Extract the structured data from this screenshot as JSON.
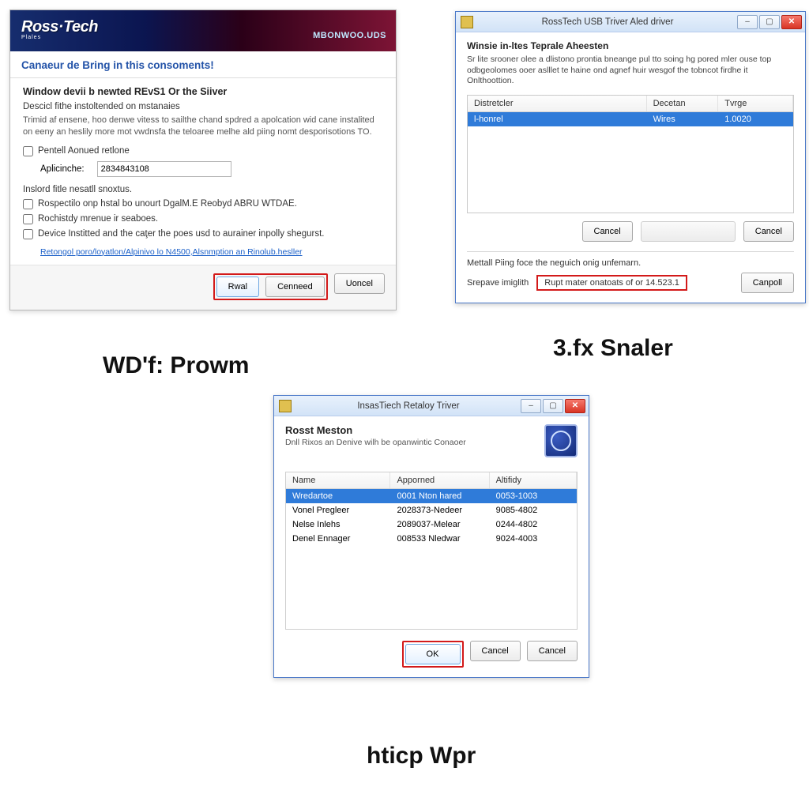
{
  "captions": {
    "c1": "WD'f: Prowm",
    "c2": "3.fx Snaler",
    "c3": "hticp Wpr"
  },
  "win1": {
    "logo_main": "Ross·Tech",
    "logo_sub": "Plales",
    "banner_right": "MBONWOO.UDS",
    "blue_heading": "Canaeur de Bring in this consoments!",
    "heading": "Window devii b newted REvS1 Or the Siiver",
    "subheading": "Descicl fithe instoltended on mstanaies",
    "description": "Trimid af ensene, hoo denwe vitess to sailthe chand spdred a apolcation wid cane instalited on eeny an heslily more mot vwdnsfa the teloaree melhe ald piing nomt desporisotions TO.",
    "chk1_label": "Pentell Aonued retlone",
    "apl_label": "Aplicinche:",
    "apl_value": "2834843108",
    "subheading2": "Inslord fitle nesatll snoxtus.",
    "chk2_label": "Rospectilo onp hstal bo unourt DgalM.E Reobyd ABRU WTDAE.",
    "chk3_label": "Rochistdy mrenue ir seaboes.",
    "chk4_label": "Device Institted and the caţer the poes usd to aurainer inpolly shegurst.",
    "link_text": "Retongol poro/loyatlon/Alpinivo lo N4500,Alsnmption an Rinolub.hesller",
    "btn_install": "Rwal",
    "btn_cancel": "Cenneed",
    "btn_uoncel": "Uoncel"
  },
  "win2": {
    "title": "RossTech USB Triver Aled driver",
    "heading": "Winsie in-ltes Teprale Aheesten",
    "paragraph": "Sr lite srooner olee a dlistono prontia bneange pul tto soing hg pored mler ouse top odbgeolomes ooer aslllet te haine ond agnef huir wesgof the tobncot firdhe it Onlthoottion.",
    "columns": {
      "c1": "Distretcler",
      "c2": "Decetan",
      "c3": "Tvrge"
    },
    "row": {
      "c1": "l-honrel",
      "c2": "Wires",
      "c3": "1.0020"
    },
    "btn_cancel_l": "Cancel",
    "btn_cancel_r": "Cancel",
    "sub_lab": "Mettall Piing foce the neguich onig unfemarn.",
    "sub_field_label": "Srepave imiglith",
    "sub_field_value": "Rupt mater onatoats of or 14.523.1",
    "btn_canpoll": "Canpoll"
  },
  "win3": {
    "title": "InsasTiech Retaloy Triver",
    "heading": "Rosst Meston",
    "sub": "Dnll Rixos an Denive wilh be opanwintic Conaoer",
    "columns": {
      "c1": "Name",
      "c2": "Apporned",
      "c3": "Altifidy"
    },
    "rows": [
      {
        "c1": "Wredartoe",
        "c2": "0001 Nton hared",
        "c3": "0053-1003"
      },
      {
        "c1": "Vonel Pregleer",
        "c2": "2028373-Nedeer",
        "c3": "9085-4802"
      },
      {
        "c1": "Nelse Inlehs",
        "c2": "2089037-Melear",
        "c3": "0244-4802"
      },
      {
        "c1": "Denel Ennager",
        "c2": "008533 Nledwar",
        "c3": "9024-4003"
      }
    ],
    "btn_ok": "OK",
    "btn_cancel1": "Cancel",
    "btn_cancel2": "Cancel"
  }
}
